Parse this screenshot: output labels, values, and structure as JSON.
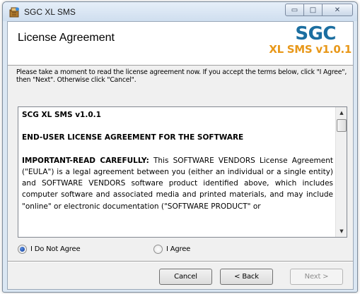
{
  "window": {
    "title": "SGC XL SMS",
    "minimize_glyph": "▭",
    "maximize_glyph": "□",
    "close_glyph": "✕",
    "icon": "installer-app-icon"
  },
  "header": {
    "title": "License Agreement",
    "logo_top": "SGC",
    "logo_bottom": "XL SMS v1.0.1",
    "logo_top_color": "#1b6ea0",
    "logo_bottom_color": "#e8981a"
  },
  "instructions": "Please take a moment to read the license agreement now. If you accept the terms below, click \"I Agree\", then \"Next\". Otherwise click \"Cancel\".",
  "license": {
    "title_line": "SCG XL SMS v1.0.1",
    "heading": "END-USER LICENSE AGREEMENT FOR THE SOFTWARE",
    "important_label": "IMPORTANT-READ CAREFULLY:",
    "body": "This SOFTWARE VENDORS License Agreement (\"EULA\") is a legal agreement between you (either an individual or a single entity) and SOFTWARE VENDORS software product identified above, which includes computer software and associated media and printed materials, and may include \"online\" or electronic documentation (\"SOFTWARE PRODUCT\" or"
  },
  "options": {
    "not_agree": "I Do Not Agree",
    "agree": "I Agree",
    "selected": "I Do Not Agree"
  },
  "buttons": {
    "cancel": "Cancel",
    "back": "< Back",
    "next": "Next >"
  }
}
